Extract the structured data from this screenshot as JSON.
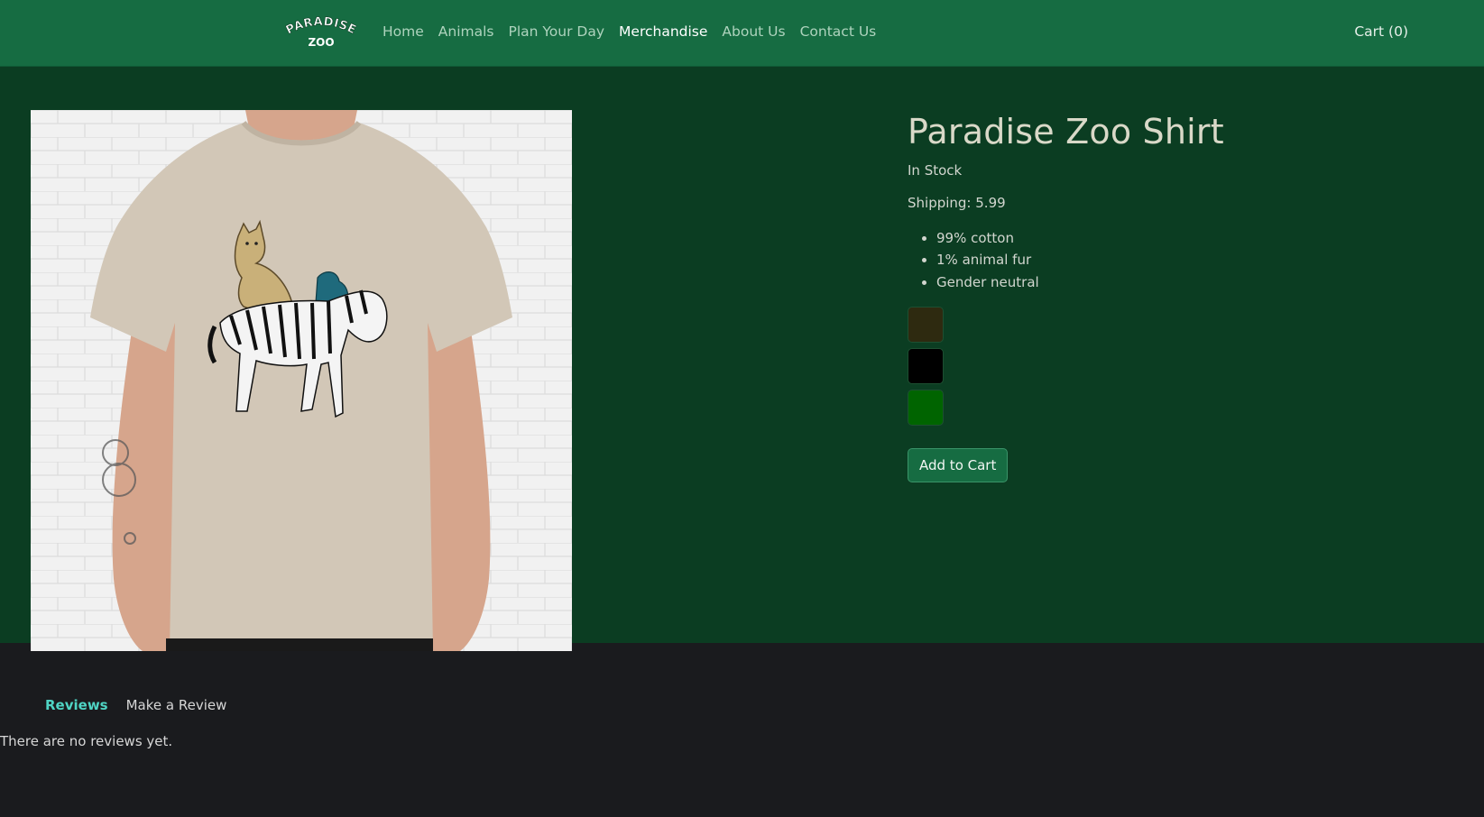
{
  "navbar": {
    "logo": {
      "line1": "PARADISE",
      "line2": "ZOO"
    },
    "links": [
      {
        "label": "Home"
      },
      {
        "label": "Animals"
      },
      {
        "label": "Plan Your Day"
      },
      {
        "label": "Merchandise"
      },
      {
        "label": "About Us"
      },
      {
        "label": "Contact Us"
      }
    ],
    "active_link": "Merchandise",
    "cart_label": "Cart (0)"
  },
  "product": {
    "title": "Paradise Zoo Shirt",
    "stock": "In Stock",
    "shipping": "Shipping: 5.99",
    "features": [
      "99% cotton",
      "1% animal fur",
      "Gender neutral"
    ],
    "colors": [
      "#2e2a10",
      "#000000",
      "#006400"
    ],
    "add_to_cart_label": "Add to Cart",
    "image_alt": "Paradise Zoo Shirt"
  },
  "reviews": {
    "tabs": [
      {
        "label": "Reviews"
      },
      {
        "label": "Make a Review"
      }
    ],
    "active_tab": "Reviews",
    "empty_text": "There are no reviews yet."
  },
  "theme": {
    "nav_bg": "#166c42",
    "product_bg": "#0b3d22",
    "page_bg": "#1a1b1e",
    "tab_accent": "#4fd4c4"
  }
}
